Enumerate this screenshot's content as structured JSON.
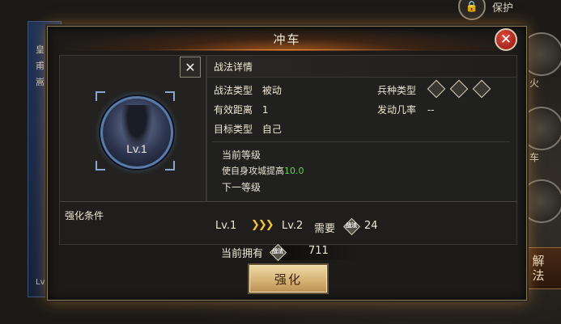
{
  "modal": {
    "title": "冲车"
  },
  "skill": {
    "level_badge": "Lv.1"
  },
  "details": {
    "header": "战法详情",
    "rows": [
      {
        "label": "战法类型",
        "value": "被动"
      },
      {
        "label": "有效距离",
        "value": "1"
      },
      {
        "label": "目标类型",
        "value": "自己"
      }
    ],
    "troop_type_label": "兵种类型",
    "trigger_rate_label": "发动几率",
    "trigger_rate_value": "--",
    "current_level_label": "当前等级",
    "current_effect_text": "使自身攻城提高",
    "current_effect_value": "10.0",
    "next_level_label": "下一等级"
  },
  "enhance": {
    "condition_label": "强化条件",
    "from_level": "Lv.1",
    "to_level": "Lv.2",
    "need_label": "需要",
    "cost": "24",
    "coin_icon_text": "战法",
    "owned_label": "当前拥有",
    "owned_value": "711",
    "button_label": "强化"
  },
  "background": {
    "protect_label": "保护",
    "left_chars": [
      "皇",
      "甫",
      "嵩"
    ],
    "left_level": "Lv.",
    "side_chars": [
      "火",
      "车"
    ],
    "unlock_label": [
      "解",
      "法"
    ]
  },
  "colors": {
    "accent_orange": "#e08a3a",
    "close_red": "#c8281d",
    "highlight_green": "#5ed84a",
    "arrow_gold": "#f5c33a",
    "button_gold": "#d7b477"
  },
  "icons": [
    "close-icon",
    "shield-troop-icon",
    "bow-troop-icon",
    "horse-troop-icon",
    "triple-chevron-icon",
    "tactic-coin-icon",
    "lock-icon"
  ]
}
